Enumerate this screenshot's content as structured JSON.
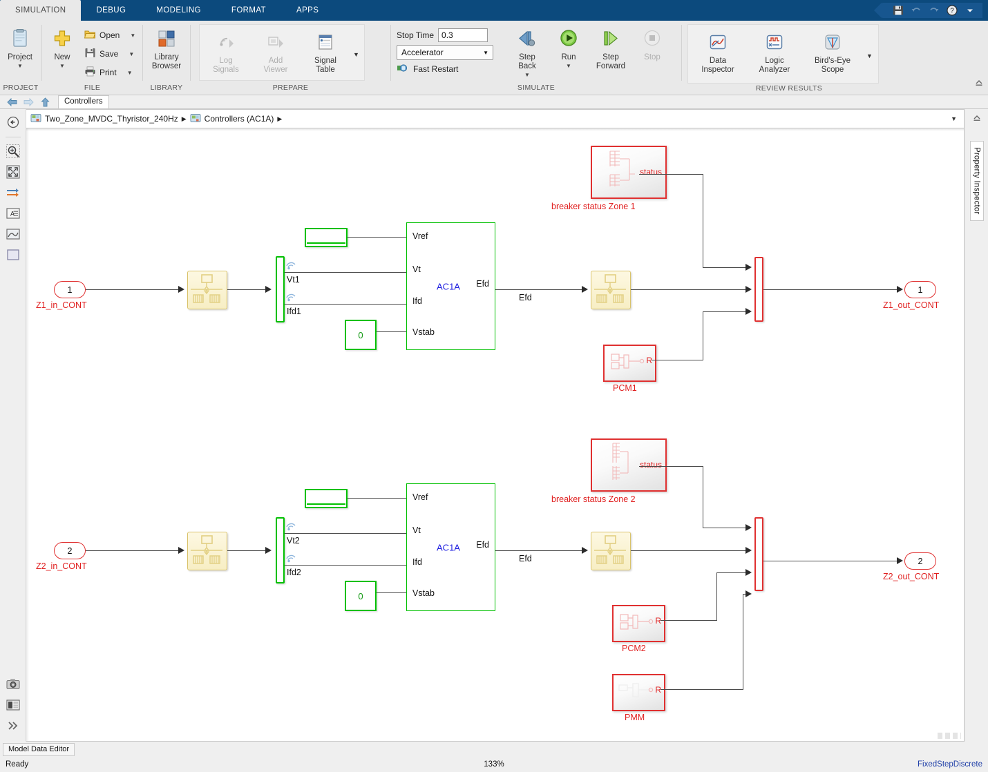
{
  "ribbon": {
    "tabs": [
      {
        "label": "SIMULATION",
        "active": true
      },
      {
        "label": "DEBUG",
        "active": false
      },
      {
        "label": "MODELING",
        "active": false
      },
      {
        "label": "FORMAT",
        "active": false
      },
      {
        "label": "APPS",
        "active": false
      }
    ],
    "quick_access": [
      "save-icon",
      "undo-icon",
      "redo-icon",
      "help-icon",
      "chevron-down-icon"
    ],
    "groups": [
      {
        "name": "PROJECT",
        "buttons": [
          {
            "label": "Project",
            "icon": "project-icon",
            "has_caret": true,
            "disabled": false
          }
        ]
      },
      {
        "name": "FILE",
        "buttons": [
          {
            "label": "New",
            "icon": "new-plus-icon",
            "has_caret": true,
            "disabled": false
          }
        ],
        "small": [
          {
            "label": "Open",
            "icon": "folder-open-icon",
            "has_caret": true
          },
          {
            "label": "Save",
            "icon": "save-disk-icon",
            "has_caret": true
          },
          {
            "label": "Print",
            "icon": "printer-icon",
            "has_caret": true
          }
        ]
      },
      {
        "name": "LIBRARY",
        "buttons": [
          {
            "label": "Library\nBrowser",
            "icon": "library-browser-icon",
            "has_caret": false,
            "disabled": false
          }
        ]
      },
      {
        "name": "PREPARE",
        "buttons": [
          {
            "label": "Log\nSignals",
            "icon": "log-signals-icon",
            "has_caret": false,
            "disabled": true
          },
          {
            "label": "Add\nViewer",
            "icon": "add-viewer-icon",
            "has_caret": false,
            "disabled": true
          },
          {
            "label": "Signal\nTable",
            "icon": "signal-table-icon",
            "has_caret": false,
            "disabled": false
          }
        ],
        "overflow_caret": true
      },
      {
        "name": "SIMULATE",
        "stop_time_label": "Stop Time",
        "stop_time_value": "0.3",
        "mode_value": "Accelerator",
        "fast_restart_label": "Fast Restart",
        "buttons": [
          {
            "label": "Step\nBack",
            "icon": "step-back-icon",
            "has_caret": true,
            "disabled": false
          },
          {
            "label": "Run",
            "icon": "run-icon",
            "has_caret": true,
            "disabled": false
          },
          {
            "label": "Step\nForward",
            "icon": "step-forward-icon",
            "has_caret": false,
            "disabled": false
          },
          {
            "label": "Stop",
            "icon": "stop-icon",
            "has_caret": false,
            "disabled": true
          }
        ]
      },
      {
        "name": "REVIEW RESULTS",
        "buttons": [
          {
            "label": "Data\nInspector",
            "icon": "data-inspector-icon",
            "has_caret": false,
            "disabled": false
          },
          {
            "label": "Logic\nAnalyzer",
            "icon": "logic-analyzer-icon",
            "has_caret": false,
            "disabled": false
          },
          {
            "label": "Bird's-Eye\nScope",
            "icon": "birds-eye-scope-icon",
            "has_caret": false,
            "disabled": false
          }
        ],
        "overflow_caret": true
      }
    ]
  },
  "model_tab": {
    "label": "Controllers"
  },
  "breadcrumb": {
    "items": [
      {
        "label": "Two_Zone_MVDC_Thyristor_240Hz",
        "icon": "model-icon"
      },
      {
        "label": "Controllers (AC1A)",
        "icon": "subsystem-icon"
      }
    ],
    "separator": "▶"
  },
  "left_toolbar": {
    "items": [
      {
        "name": "navigate-up-icon"
      },
      {
        "name": "zoom-fit-selection-icon"
      },
      {
        "name": "fit-to-view-icon"
      },
      {
        "name": "signal-routing-icon"
      },
      {
        "name": "annotation-icon"
      },
      {
        "name": "image-annotation-icon"
      },
      {
        "name": "area-icon"
      }
    ],
    "bottom_items": [
      {
        "name": "camera-snapshot-icon"
      },
      {
        "name": "model-info-icon"
      },
      {
        "name": "expand-more-icon"
      }
    ]
  },
  "right_panel": {
    "label": "Property Inspector"
  },
  "status": {
    "model_data_editor": "Model Data Editor",
    "ready": "Ready",
    "zoom": "133%",
    "solver": "FixedStepDiscrete"
  },
  "diagram": {
    "zones": [
      {
        "id": "zone1",
        "inport_number": "1",
        "inport_label": "Z1_in_CONT",
        "outport_number": "1",
        "outport_label": "Z1_out_CONT",
        "goto_block": "measurement-block",
        "selector_signals": [
          "Vt1",
          "Ifd1"
        ],
        "subsystem_name": "AC1A",
        "subsystem_inputs": [
          "Vref",
          "Vt",
          "Ifd",
          "Vstab"
        ],
        "subsystem_output": "Efd",
        "signal_label": "Efd",
        "constant_value": "0",
        "breaker_block_label": "breaker status Zone 1",
        "breaker_port": "status",
        "machine_blocks": [
          {
            "label": "PCM1",
            "port": "R"
          }
        ],
        "mux_inputs": 3
      },
      {
        "id": "zone2",
        "inport_number": "2",
        "inport_label": "Z2_in_CONT",
        "outport_number": "2",
        "outport_label": "Z2_out_CONT",
        "goto_block": "measurement-block",
        "selector_signals": [
          "Vt2",
          "Ifd2"
        ],
        "subsystem_name": "AC1A",
        "subsystem_inputs": [
          "Vref",
          "Vt",
          "Ifd",
          "Vstab"
        ],
        "subsystem_output": "Efd",
        "signal_label": "Efd",
        "constant_value": "0",
        "breaker_block_label": "breaker status Zone 2",
        "breaker_port": "status",
        "machine_blocks": [
          {
            "label": "PCM2",
            "port": "R"
          },
          {
            "label": "PMM",
            "port": "R"
          }
        ],
        "mux_inputs": 4
      }
    ]
  },
  "colors": {
    "ribbon_blue": "#0c4a7d",
    "red_block": "#e03030",
    "green_block": "#00c000",
    "yellow_block": "#d9c26a",
    "subsystem_name": "#2020e0",
    "solver_text": "#1f3fa8"
  }
}
